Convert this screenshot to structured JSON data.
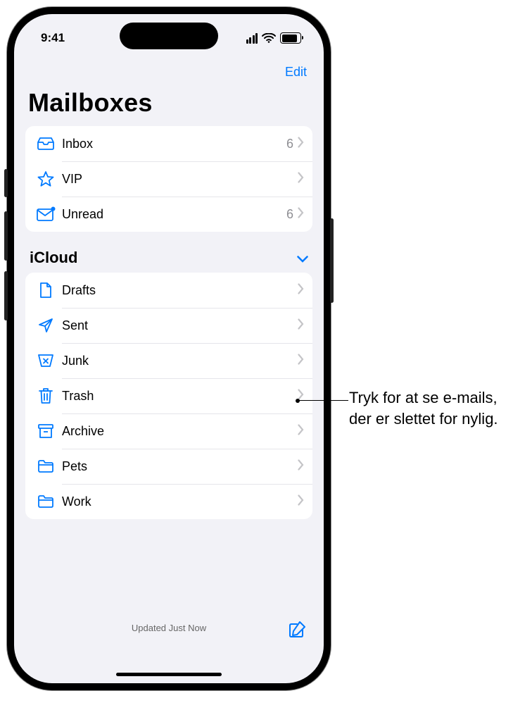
{
  "status": {
    "time": "9:41"
  },
  "nav": {
    "edit": "Edit"
  },
  "title": "Mailboxes",
  "primary": [
    {
      "icon": "inbox",
      "label": "Inbox",
      "count": "6"
    },
    {
      "icon": "star",
      "label": "VIP",
      "count": ""
    },
    {
      "icon": "unread",
      "label": "Unread",
      "count": "6"
    }
  ],
  "section": {
    "title": "iCloud"
  },
  "icloud": [
    {
      "icon": "drafts",
      "label": "Drafts"
    },
    {
      "icon": "sent",
      "label": "Sent"
    },
    {
      "icon": "junk",
      "label": "Junk"
    },
    {
      "icon": "trash",
      "label": "Trash"
    },
    {
      "icon": "archive",
      "label": "Archive"
    },
    {
      "icon": "folder",
      "label": "Pets"
    },
    {
      "icon": "folder",
      "label": "Work"
    }
  ],
  "toolbar": {
    "status": "Updated Just Now"
  },
  "callout": "Tryk for at se e-mails, der er slettet for nylig."
}
